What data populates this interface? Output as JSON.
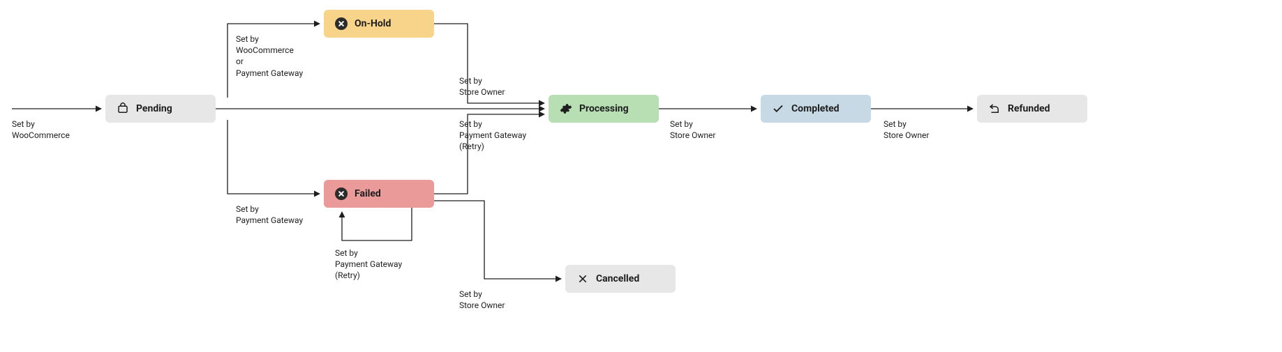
{
  "nodes": {
    "pending": {
      "label": "Pending",
      "icon": "cart-icon"
    },
    "onhold": {
      "label": "On-Hold",
      "icon": "circle-x-icon"
    },
    "failed": {
      "label": "Failed",
      "icon": "circle-x-icon"
    },
    "processing": {
      "label": "Processing",
      "icon": "gear-icon"
    },
    "completed": {
      "label": "Completed",
      "icon": "check-icon"
    },
    "cancelled": {
      "label": "Cancelled",
      "icon": "x-icon"
    },
    "refunded": {
      "label": "Refunded",
      "icon": "refund-icon"
    }
  },
  "edges": {
    "start_to_pending": {
      "label": "Set by\nWooCommerce"
    },
    "pending_to_onhold": {
      "label": "Set by\nWooCommerce\nor\nPayment Gateway"
    },
    "pending_to_failed": {
      "label": "Set by\nPayment Gateway"
    },
    "pending_to_processing": {
      "label": ""
    },
    "onhold_to_processing": {
      "label": "Set by\nStore Owner"
    },
    "failed_to_processing": {
      "label": "Set by\nPayment Gateway\n(Retry)"
    },
    "failed_to_failed": {
      "label": "Set by\nPayment Gateway\n(Retry)"
    },
    "failed_to_cancelled": {
      "label": "Set by\nStore Owner"
    },
    "processing_to_completed": {
      "label": "Set by\nStore Owner"
    },
    "completed_to_refunded": {
      "label": "Set by\nStore Owner"
    }
  },
  "chart_data": {
    "type": "flow-diagram",
    "title": "WooCommerce order status flow",
    "states": [
      {
        "id": "pending",
        "label": "Pending",
        "color": "#e7e7e7"
      },
      {
        "id": "onhold",
        "label": "On-Hold",
        "color": "#f7d48a"
      },
      {
        "id": "failed",
        "label": "Failed",
        "color": "#eb9a9a"
      },
      {
        "id": "processing",
        "label": "Processing",
        "color": "#b7dfb3"
      },
      {
        "id": "completed",
        "label": "Completed",
        "color": "#c7d9e4"
      },
      {
        "id": "cancelled",
        "label": "Cancelled",
        "color": "#e7e7e7"
      },
      {
        "id": "refunded",
        "label": "Refunded",
        "color": "#e7e7e7"
      }
    ],
    "transitions": [
      {
        "from": null,
        "to": "pending",
        "set_by": "WooCommerce"
      },
      {
        "from": "pending",
        "to": "onhold",
        "set_by": "WooCommerce or Payment Gateway"
      },
      {
        "from": "pending",
        "to": "failed",
        "set_by": "Payment Gateway"
      },
      {
        "from": "pending",
        "to": "processing",
        "set_by": ""
      },
      {
        "from": "onhold",
        "to": "processing",
        "set_by": "Store Owner"
      },
      {
        "from": "failed",
        "to": "processing",
        "set_by": "Payment Gateway (Retry)"
      },
      {
        "from": "failed",
        "to": "failed",
        "set_by": "Payment Gateway (Retry)"
      },
      {
        "from": "failed",
        "to": "cancelled",
        "set_by": "Store Owner"
      },
      {
        "from": "processing",
        "to": "completed",
        "set_by": "Store Owner"
      },
      {
        "from": "completed",
        "to": "refunded",
        "set_by": "Store Owner"
      }
    ]
  }
}
